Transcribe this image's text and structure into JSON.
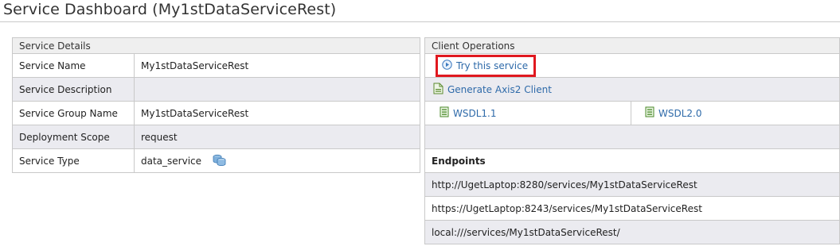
{
  "page": {
    "title": "Service Dashboard (My1stDataServiceRest)"
  },
  "service_details": {
    "header": "Service Details",
    "rows": [
      {
        "label": "Service Name",
        "value": "My1stDataServiceRest"
      },
      {
        "label": "Service Description",
        "value": ""
      },
      {
        "label": "Service Group Name",
        "value": "My1stDataServiceRest"
      },
      {
        "label": "Deployment Scope",
        "value": "request"
      },
      {
        "label": "Service Type",
        "value": "data_service",
        "icon": "database-icon"
      }
    ]
  },
  "client_operations": {
    "header": "Client Operations",
    "try_service": {
      "label": "Try this service",
      "icon": "play-circle-icon"
    },
    "generate_client": {
      "label": "Generate Axis2 Client",
      "icon": "document-icon"
    },
    "wsdl1": {
      "label": "WSDL1.1",
      "icon": "wsdl-doc-icon"
    },
    "wsdl2": {
      "label": "WSDL2.0",
      "icon": "wsdl-doc-icon"
    },
    "endpoints": {
      "header": "Endpoints",
      "items": [
        "http://UgetLaptop:8280/services/My1stDataServiceRest",
        "https://UgetLaptop:8243/services/My1stDataServiceRest",
        "local:///services/My1stDataServiceRest/"
      ]
    }
  },
  "colors": {
    "link": "#2e6aa9",
    "highlight": "#e0181f",
    "alt_row": "#ebebf0",
    "header_bg": "#efefef"
  }
}
